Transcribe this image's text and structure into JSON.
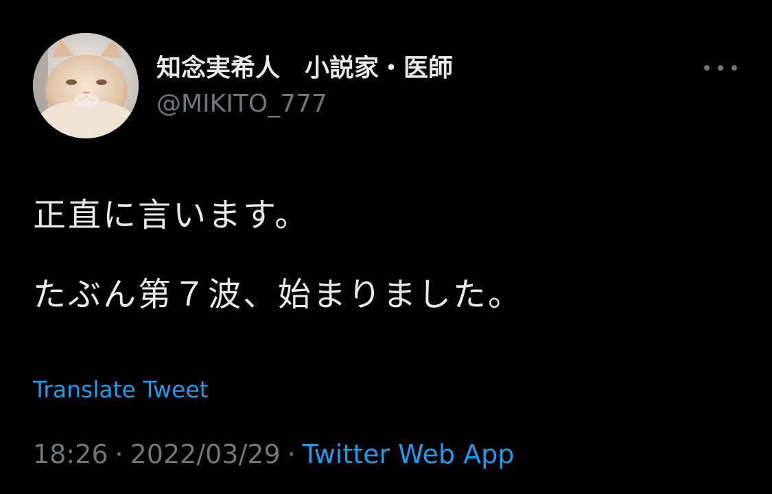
{
  "author": {
    "display_name": "知念実希人　小説家・医師",
    "handle": "@MIKITO_777",
    "avatar": "cat-photo-avatar"
  },
  "more_icon": "more-horizontal-icon",
  "tweet": {
    "lines": [
      "正直に言います。",
      "たぶん第７波、始まりました。"
    ],
    "translate_label": "Translate Tweet",
    "time": "18:26",
    "date": "2022/03/29",
    "separator": "·",
    "source": "Twitter Web App"
  },
  "colors": {
    "background": "#000000",
    "text": "#e7e9ea",
    "secondary": "#71767b",
    "link": "#1d9bf0"
  }
}
